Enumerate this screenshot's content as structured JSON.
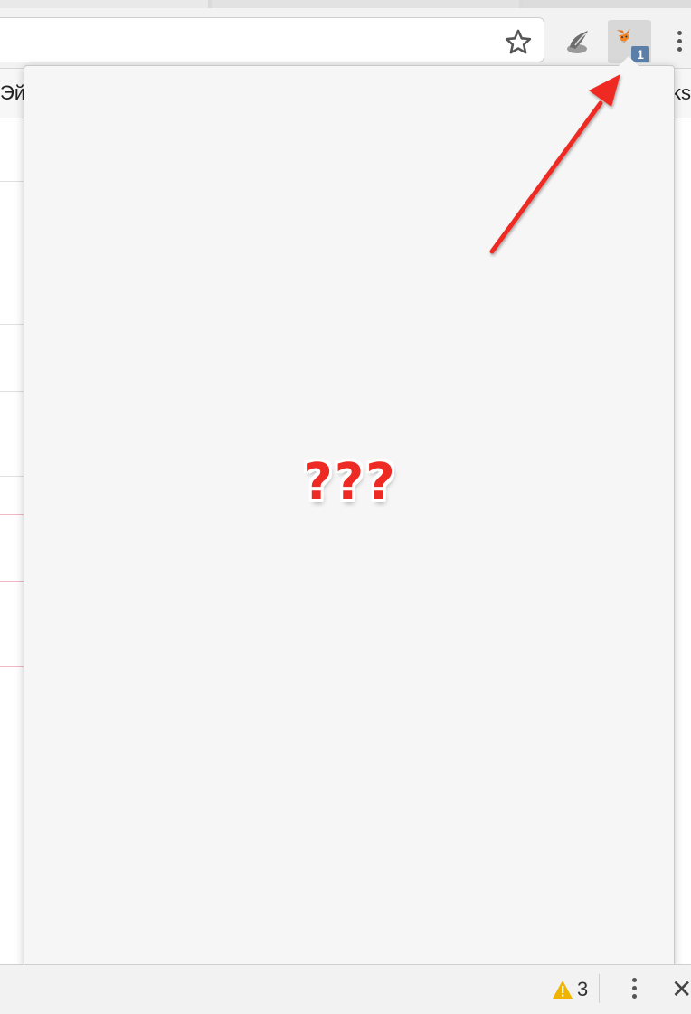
{
  "bookmarks": {
    "left_fragment": "Эй",
    "right_fragment": "ks"
  },
  "extensions": {
    "metamask_badge": "1"
  },
  "popup": {
    "placeholder_text": "???"
  },
  "statusbar": {
    "warning_count": "3",
    "close_glyph": "✕"
  },
  "colors": {
    "arrow": "#ee2a24",
    "badge": "#5b7fa6",
    "popup_bg": "#f6f6f6"
  },
  "icons": [
    "star-icon",
    "extension-icon",
    "metamask-fox-icon",
    "menu-dots-icon",
    "warning-icon",
    "close-icon",
    "annotation-arrow"
  ]
}
